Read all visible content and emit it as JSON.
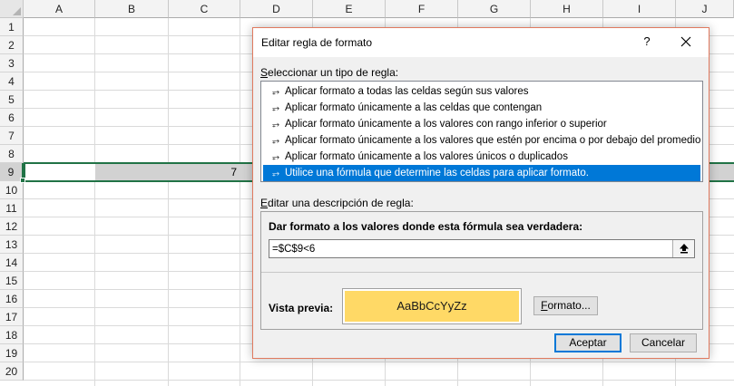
{
  "sheet": {
    "columns": [
      "A",
      "B",
      "C",
      "D",
      "E",
      "F",
      "G",
      "H",
      "I",
      "J"
    ],
    "rows": [
      "1",
      "2",
      "3",
      "4",
      "5",
      "6",
      "7",
      "8",
      "9",
      "10",
      "11",
      "12",
      "13",
      "14",
      "15",
      "16",
      "17",
      "18",
      "19",
      "20"
    ],
    "selected_row": "9",
    "visible_cell_value": "7",
    "accent_color": "#217346"
  },
  "dialog": {
    "title": "Editar regla de formato",
    "help_label": "?",
    "select_type": {
      "label_accel": "S",
      "label_rest": "eleccionar un tipo de regla:"
    },
    "rule_types": [
      "Aplicar formato a todas las celdas según sus valores",
      "Aplicar formato únicamente a las celdas que contengan",
      "Aplicar formato únicamente a los valores con rango inferior o superior",
      "Aplicar formato únicamente a los valores que estén por encima o por debajo del promedio",
      "Aplicar formato únicamente a los valores únicos o duplicados",
      "Utilice una fórmula que determine las celdas para aplicar formato."
    ],
    "selected_rule_index": 5,
    "rule_arrow_glyph": "⥅",
    "edit_description": {
      "label_accel": "E",
      "label_rest": "ditar una descripción de regla:"
    },
    "formula_heading": "Dar formato a los valores donde esta fórmula sea verdadera:",
    "formula_value": "=$C$9<6",
    "preview": {
      "label": "Vista previa:",
      "sample_text": "AaBbCcYyZz",
      "fill_color": "#ffd966"
    },
    "buttons": {
      "format_accel": "F",
      "format_rest": "ormato...",
      "accept": "Aceptar",
      "cancel": "Cancelar"
    },
    "selection_color": "#0078d7"
  }
}
